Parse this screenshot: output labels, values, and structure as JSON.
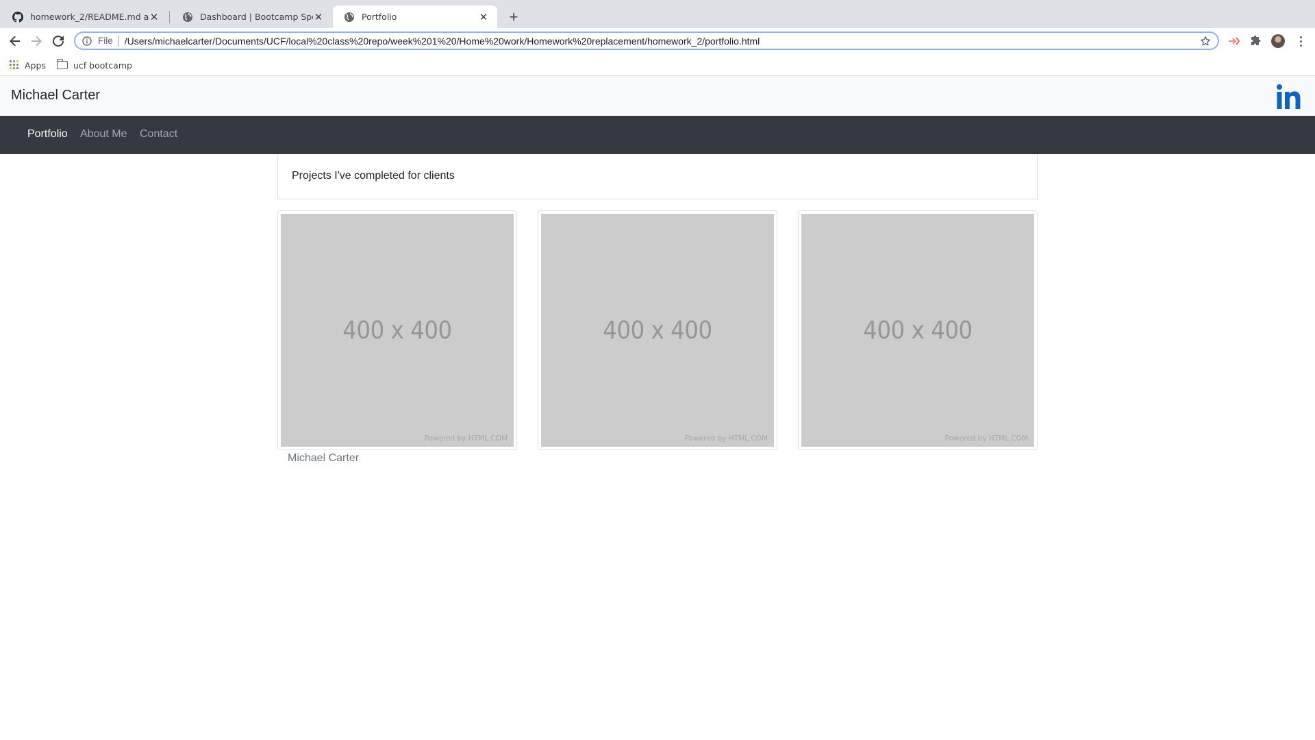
{
  "browser": {
    "tabs": [
      {
        "title": "homework_2/README.md at m",
        "icon": "github-icon",
        "active": false
      },
      {
        "title": "Dashboard | Bootcamp Spot",
        "icon": "globe-icon",
        "active": false
      },
      {
        "title": "Portfolio",
        "icon": "globe-icon",
        "active": true
      }
    ],
    "omnibox": {
      "scheme_label": "File",
      "url": "/Users/michaelcarter/Documents/UCF/local%20class%20repo/week%201%20/Home%20work/Homework%20replacement/homework_2/portfolio.html"
    },
    "bookmarks": [
      {
        "label": "Apps",
        "icon": "apps-grid-icon"
      },
      {
        "label": "ucf bootcamp",
        "icon": "folder-icon"
      }
    ]
  },
  "site": {
    "brand": "Michael Carter",
    "social_icon": "linkedin-icon",
    "nav": [
      {
        "label": "Portfolio",
        "active": true
      },
      {
        "label": "About Me",
        "active": false
      },
      {
        "label": "Contact",
        "active": false
      }
    ],
    "intro": "Projects I've completed for clients",
    "placeholders": [
      {
        "size_text": "400 x 400",
        "credit": "Powered by HTML.COM"
      },
      {
        "size_text": "400 x 400",
        "credit": "Powered by HTML.COM"
      },
      {
        "size_text": "400 x 400",
        "credit": "Powered by HTML.COM"
      }
    ],
    "footer_name": "Michael Carter"
  },
  "colors": {
    "tabstrip": "#dee1e6",
    "navbar": "#343a40",
    "header": "#f8f9fa",
    "linkedin": "#0a66c2",
    "placeholder": "#cccccc"
  }
}
